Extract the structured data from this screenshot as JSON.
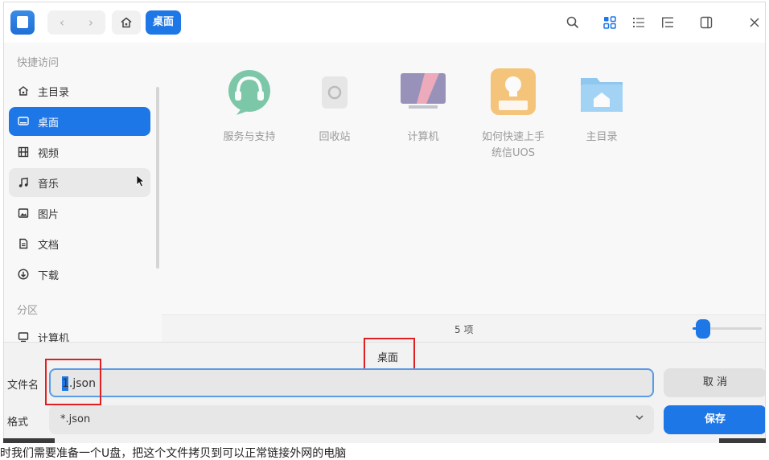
{
  "titlebar": {
    "nav_back": "‹",
    "nav_forward": "›",
    "breadcrumb_current": "桌面",
    "icons": [
      "search-icon",
      "icon-view-icon",
      "list-view-icon",
      "tree-view-icon",
      "detail-panel-icon",
      "close-icon"
    ]
  },
  "sidebar": {
    "section_quick": "快捷访问",
    "section_partition": "分区",
    "items": [
      {
        "label": "主目录",
        "icon": "home-icon"
      },
      {
        "label": "桌面",
        "icon": "desktop-icon",
        "state": "selected"
      },
      {
        "label": "视频",
        "icon": "video-icon"
      },
      {
        "label": "音乐",
        "icon": "music-icon",
        "state": "hover"
      },
      {
        "label": "图片",
        "icon": "picture-icon"
      },
      {
        "label": "文档",
        "icon": "document-icon"
      },
      {
        "label": "下载",
        "icon": "download-icon"
      },
      {
        "label": "计算机",
        "icon": "computer-icon"
      }
    ]
  },
  "files": [
    {
      "name": "服务与支持",
      "icon": "support-headset-icon"
    },
    {
      "name": "回收站",
      "icon": "trash-icon"
    },
    {
      "name": "计算机",
      "icon": "computer-icon"
    },
    {
      "name_line1": "如何快速上手",
      "name_line2": "统信UOS",
      "icon": "uos-guide-icon"
    },
    {
      "name": "主目录",
      "icon": "home-folder-icon"
    }
  ],
  "status": {
    "count": "5 项",
    "zoom_level": 0.15
  },
  "save": {
    "location": "桌面",
    "filename_label": "文件名",
    "filename_selected": "1",
    "filename_value": "1.json",
    "format_label": "格式",
    "format_value": "*.json",
    "cancel_label": "取 消",
    "save_label": "保存"
  },
  "caption": "时我们需要准备一个U盘，把这个文件拷贝到可以正常链接外网的电脑",
  "colors": {
    "accent": "#1e77e6",
    "highlight_box": "#e02020"
  }
}
